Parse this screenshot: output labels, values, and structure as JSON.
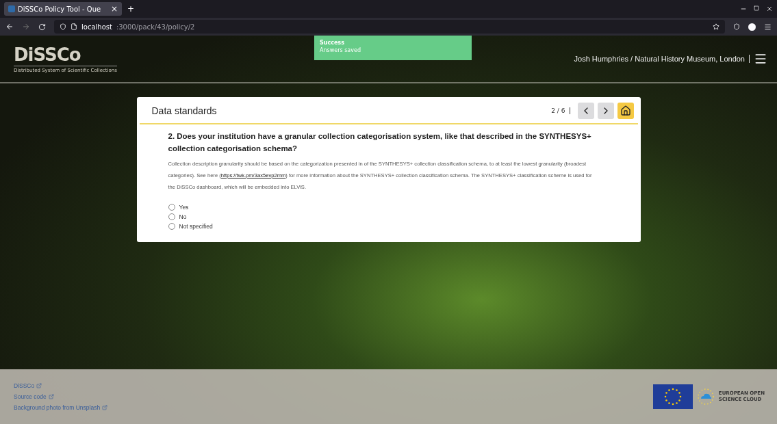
{
  "browser": {
    "tab_title": "DiSSCo Policy Tool - Que",
    "tab_close": "×",
    "new_tab": "+",
    "url_host": "localhost",
    "url_path": ":3000/pack/43/policy/2"
  },
  "header": {
    "logo": "DiSSCo",
    "logo_subtitle": "Distributed System of Scientific Collections",
    "user": "Josh Humphries / Natural History Museum, London"
  },
  "toast": {
    "title": "Success",
    "message": "Answers saved"
  },
  "card": {
    "title": "Data standards",
    "progress": "2 / 6",
    "question": "2. Does your institution have a granular collection categorisation system, like that described in the SYNTHESYS+ collection categorisation schema?",
    "help_before": "Collection description granularity should be based on the categorization presented in of the SYNTHESYS+ collection classification schema, to at least the lowest granularity (broadest categories). See here (",
    "help_link": "https://twk.pm/3ax5evp2mm",
    "help_after": ") for more information about the SYNTHESYS+ collection classification schema. The SYNTHESYS+ classification scheme is used for the DiSSCo dashboard, which will be embedded into ELViS.",
    "options": [
      {
        "label": "Yes",
        "selected": false
      },
      {
        "label": "No",
        "selected": false
      },
      {
        "label": "Not specified",
        "selected": false
      }
    ]
  },
  "footer": {
    "links": [
      "DiSSCo",
      "Source code",
      "Background photo from Unsplash"
    ],
    "eosc_line1": "EUROPEAN OPEN",
    "eosc_line2": "SCIENCE CLOUD"
  }
}
